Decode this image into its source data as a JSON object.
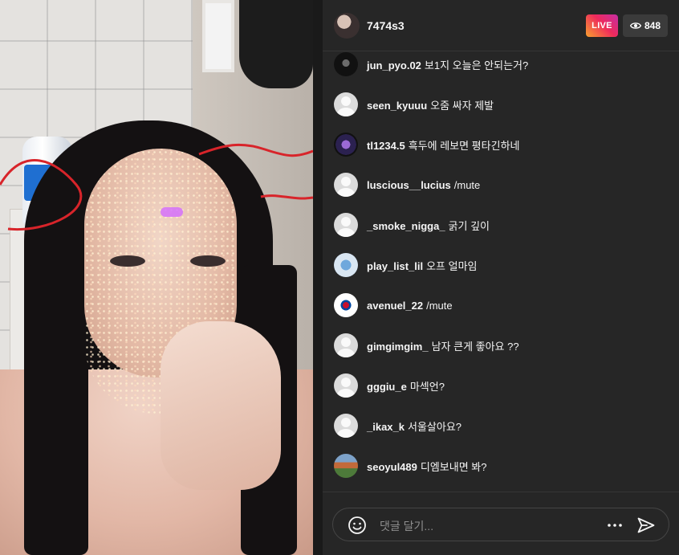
{
  "header": {
    "host_name": "7474s3",
    "live_label": "LIVE",
    "viewer_count": "848"
  },
  "comments": [
    {
      "user": "jun_pyo.02",
      "message": "보1지 오늘은 안되는거?",
      "avatar": "dark-photo"
    },
    {
      "user": "seen_kyuuu",
      "message": "오줌 싸자 제발",
      "avatar": "default"
    },
    {
      "user": "tl1234.5",
      "message": "흑두에 레보면 평타긴하네",
      "avatar": "anime-photo"
    },
    {
      "user": "luscious__lucius",
      "message": "/mute",
      "avatar": "default"
    },
    {
      "user": "_smoke_nigga_",
      "message": "굵기 깊이",
      "avatar": "default"
    },
    {
      "user": "play_list_lil",
      "message": "오프 얼마임",
      "avatar": "cartoon-photo"
    },
    {
      "user": "avenuel_22",
      "message": "/mute",
      "avatar": "flag-photo"
    },
    {
      "user": "gimgimgim_",
      "message": "남자 큰게 좋아요 ??",
      "avatar": "default"
    },
    {
      "user": "gggiu_e",
      "message": "마섹언?",
      "avatar": "default"
    },
    {
      "user": "_ikax_k",
      "message": "서울살아요?",
      "avatar": "default"
    },
    {
      "user": "seoyul489",
      "message": "디엠보내면 봐?",
      "avatar": "landscape-photo"
    }
  ],
  "composer": {
    "placeholder": "댓글 달기...",
    "emoji_icon": "smiley-icon",
    "more_icon": "more-horizontal-icon",
    "send_icon": "send-icon"
  },
  "colors": {
    "panel_bg": "#262626",
    "live_gradient_start": "#f7a12f",
    "live_gradient_end": "#c72ea6",
    "text": "#f5f5f5",
    "placeholder": "#8e8e8e"
  }
}
